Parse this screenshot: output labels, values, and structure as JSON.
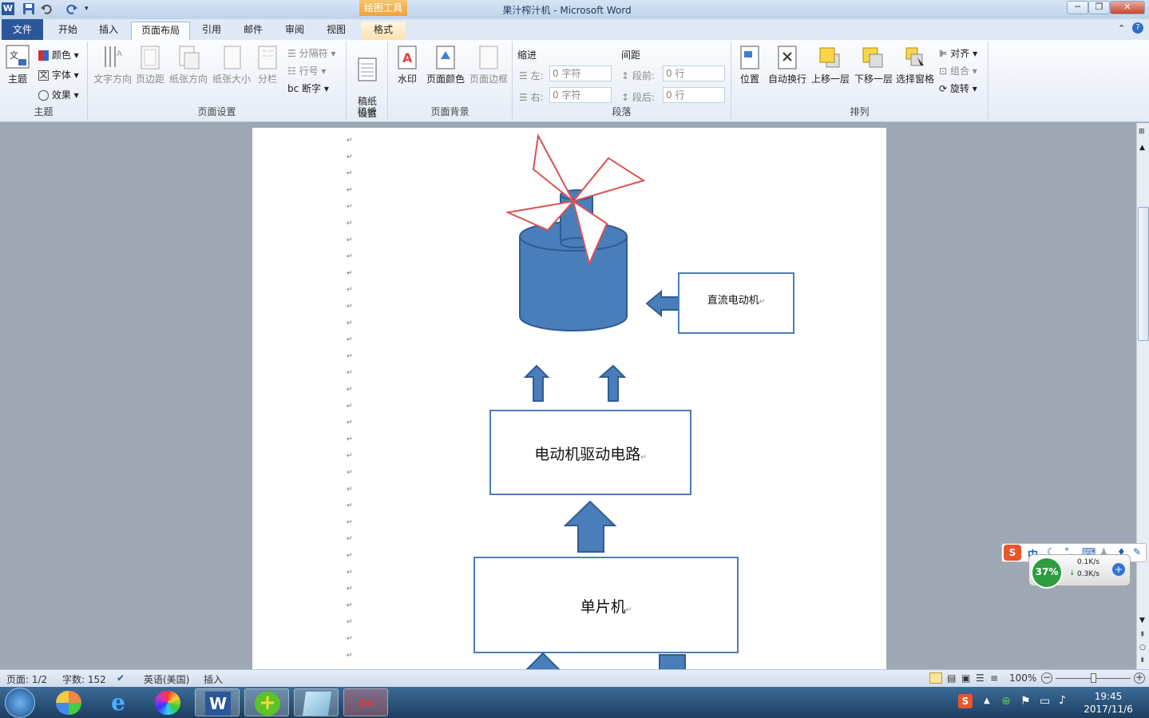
{
  "app": {
    "title": "果汁榨汁机 - Microsoft Word",
    "context_tab_group": "绘图工具",
    "window_controls": [
      "minimize-icon",
      "restore-icon",
      "close-icon"
    ]
  },
  "tabs": [
    {
      "label": "文件"
    },
    {
      "label": "开始"
    },
    {
      "label": "插入"
    },
    {
      "label": "页面布局",
      "active": true
    },
    {
      "label": "引用"
    },
    {
      "label": "邮件"
    },
    {
      "label": "审阅"
    },
    {
      "label": "视图"
    },
    {
      "label": "格式"
    }
  ],
  "ribbon": {
    "theme_group": {
      "label": "主题",
      "theme": "主题",
      "colors": "颜色",
      "fonts": "字体",
      "effects": "效果"
    },
    "page_setup": {
      "label": "页面设置",
      "text_direction": "文字方向",
      "margins": "页边距",
      "orientation": "纸张方向",
      "size": "纸张大小",
      "columns": "分栏",
      "breaks": "分隔符",
      "line_numbers": "行号",
      "hyphenation": "断字"
    },
    "draft_paper": {
      "label": "稿纸",
      "setup": "稿纸\n设置"
    },
    "page_background": {
      "label": "页面背景",
      "watermark": "水印",
      "page_color": "页面颜色",
      "page_borders": "页面边框"
    },
    "paragraph": {
      "label": "段落",
      "indent_heading": "缩进",
      "spacing_heading": "间距",
      "left_label": "左:",
      "right_label": "右:",
      "before_label": "段前:",
      "after_label": "段后:",
      "left_value": "0 字符",
      "right_value": "0 字符",
      "before_value": "0 行",
      "after_value": "0 行"
    },
    "arrange": {
      "label": "排列",
      "position": "位置",
      "wrap_text": "自动换行",
      "bring_forward": "上移一层",
      "send_backward": "下移一层",
      "selection_pane": "选择窗格",
      "align": "对齐",
      "group": "组合",
      "rotate": "旋转"
    }
  },
  "document": {
    "diagram": {
      "motor_label": "直流电动机",
      "driver_label": "电动机驱动电路",
      "mcu_label": "单片机"
    }
  },
  "status_bar": {
    "page": "页面: 1/2",
    "word_count": "字数: 152",
    "language": "英语(美国)",
    "mode": "插入",
    "zoom": "100%"
  },
  "ime": {
    "mode": "中"
  },
  "net_monitor": {
    "percent": "37%",
    "up": "0.1K/s",
    "down": "0.3K/s"
  },
  "clock": {
    "time": "19:45",
    "date": "2017/11/6"
  },
  "taskbar": {
    "items": [
      "start-orb-icon",
      "photo-app-icon",
      "ie-icon",
      "color-app-icon",
      "word-icon",
      "360-icon",
      "notepad-icon",
      "snipping-tool-icon"
    ]
  }
}
